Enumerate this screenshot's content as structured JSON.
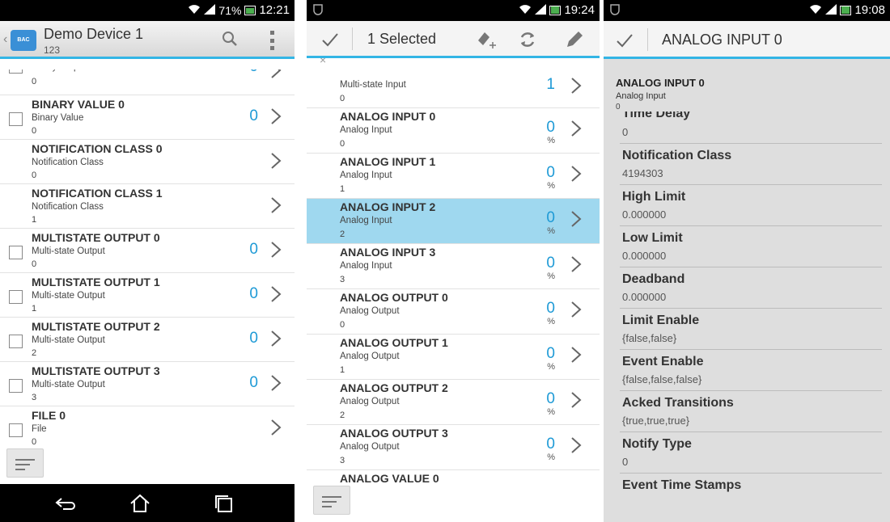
{
  "screen1": {
    "status": {
      "battery_pct": "71%",
      "time": "12:21"
    },
    "app_icon_label": "BAC",
    "title": "Demo Device 1",
    "subtitle": "123",
    "partial_row": {
      "type": "Binary Output",
      "instance": "0",
      "value": "0"
    },
    "rows": [
      {
        "name": "BINARY VALUE 0",
        "type": "Binary Value",
        "instance": "0",
        "value": "0",
        "checkbox": true
      },
      {
        "name": "NOTIFICATION CLASS 0",
        "type": "Notification Class",
        "instance": "0",
        "value": "",
        "checkbox": false
      },
      {
        "name": "NOTIFICATION CLASS 1",
        "type": "Notification Class",
        "instance": "1",
        "value": "",
        "checkbox": false
      },
      {
        "name": "MULTISTATE OUTPUT 0",
        "type": "Multi-state Output",
        "instance": "0",
        "value": "0",
        "checkbox": true
      },
      {
        "name": "MULTISTATE OUTPUT 1",
        "type": "Multi-state Output",
        "instance": "1",
        "value": "0",
        "checkbox": true
      },
      {
        "name": "MULTISTATE OUTPUT 2",
        "type": "Multi-state Output",
        "instance": "2",
        "value": "0",
        "checkbox": true
      },
      {
        "name": "MULTISTATE OUTPUT 3",
        "type": "Multi-state Output",
        "instance": "3",
        "value": "0",
        "checkbox": true
      },
      {
        "name": "FILE 0",
        "type": "File",
        "instance": "0",
        "value": "",
        "checkbox": true
      }
    ]
  },
  "screen2": {
    "status": {
      "time": "19:24"
    },
    "title": "1 Selected",
    "close_glyph": "×",
    "first_row": {
      "type": "Multi-state Input",
      "instance": "0",
      "value": "1"
    },
    "rows": [
      {
        "name": "ANALOG INPUT 0",
        "type": "Analog Input",
        "instance": "0",
        "value": "0",
        "unit": "%",
        "selected": false
      },
      {
        "name": "ANALOG INPUT 1",
        "type": "Analog Input",
        "instance": "1",
        "value": "0",
        "unit": "%",
        "selected": false
      },
      {
        "name": "ANALOG INPUT 2",
        "type": "Analog Input",
        "instance": "2",
        "value": "0",
        "unit": "%",
        "selected": true
      },
      {
        "name": "ANALOG INPUT 3",
        "type": "Analog Input",
        "instance": "3",
        "value": "0",
        "unit": "%",
        "selected": false
      },
      {
        "name": "ANALOG OUTPUT 0",
        "type": "Analog Output",
        "instance": "0",
        "value": "0",
        "unit": "%",
        "selected": false
      },
      {
        "name": "ANALOG OUTPUT 1",
        "type": "Analog Output",
        "instance": "1",
        "value": "0",
        "unit": "%",
        "selected": false
      },
      {
        "name": "ANALOG OUTPUT 2",
        "type": "Analog Output",
        "instance": "2",
        "value": "0",
        "unit": "%",
        "selected": false
      },
      {
        "name": "ANALOG OUTPUT 3",
        "type": "Analog Output",
        "instance": "3",
        "value": "0",
        "unit": "%",
        "selected": false
      },
      {
        "name": "ANALOG VALUE 0",
        "type": "",
        "instance": "",
        "value": "",
        "unit": "",
        "selected": false
      }
    ]
  },
  "screen3": {
    "status": {
      "time": "19:08"
    },
    "title": "ANALOG INPUT 0",
    "header": {
      "name": "ANALOG INPUT 0",
      "type": "Analog Input",
      "instance": "0"
    },
    "partial_prop": {
      "name": "Time Delay",
      "value": "0"
    },
    "props": [
      {
        "name": "Notification Class",
        "value": "4194303"
      },
      {
        "name": "High Limit",
        "value": "0.000000"
      },
      {
        "name": "Low Limit",
        "value": "0.000000"
      },
      {
        "name": "Deadband",
        "value": "0.000000"
      },
      {
        "name": "Limit Enable",
        "value": "{false,false}"
      },
      {
        "name": "Event Enable",
        "value": "{false,false,false}"
      },
      {
        "name": "Acked Transitions",
        "value": "{true,true,true}"
      },
      {
        "name": "Notify Type",
        "value": "0"
      },
      {
        "name": "Event Time Stamps",
        "value": ""
      }
    ]
  },
  "colors": {
    "accent": "#33b5e5",
    "value_blue": "#1e9ad6",
    "selected_row": "#9fd8ef",
    "detail_bg": "#dedede"
  }
}
